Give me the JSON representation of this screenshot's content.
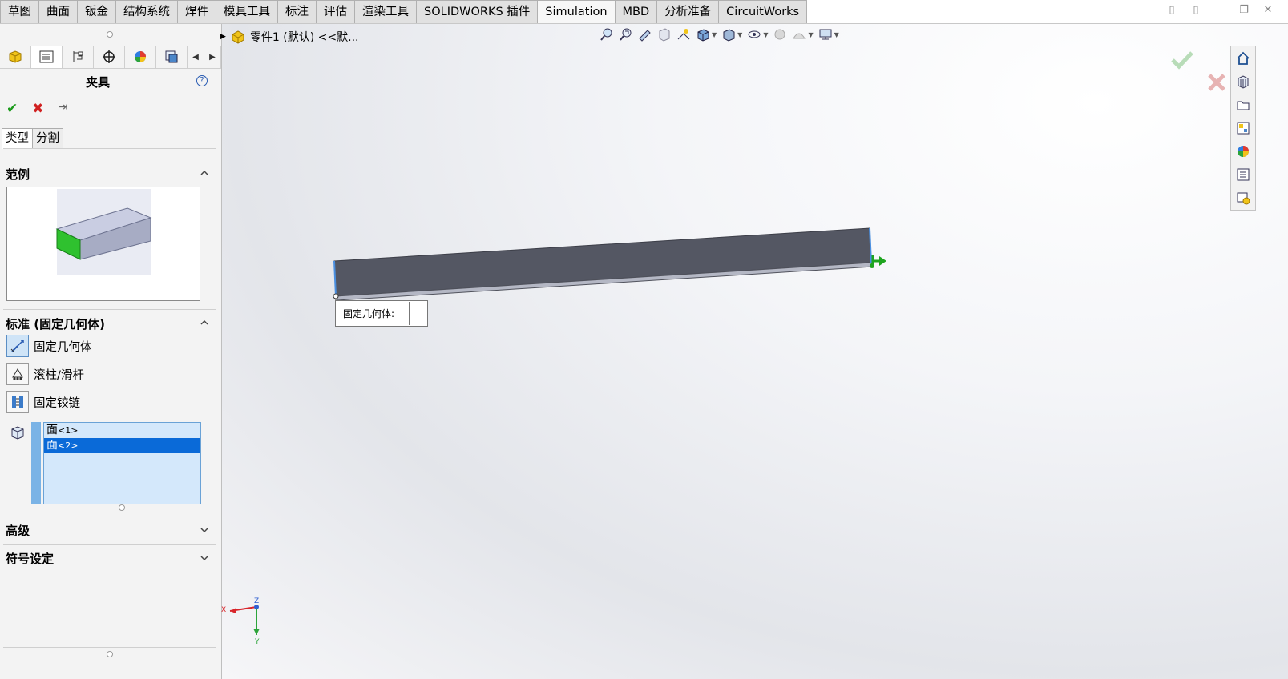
{
  "tabs": [
    {
      "label": "草图",
      "active": false
    },
    {
      "label": "曲面",
      "active": false
    },
    {
      "label": "钣金",
      "active": false
    },
    {
      "label": "结构系统",
      "active": false
    },
    {
      "label": "焊件",
      "active": false
    },
    {
      "label": "模具工具",
      "active": false
    },
    {
      "label": "标注",
      "active": false
    },
    {
      "label": "评估",
      "active": false
    },
    {
      "label": "渲染工具",
      "active": false
    },
    {
      "label": "SOLIDWORKS 插件",
      "active": false
    },
    {
      "label": "Simulation",
      "active": true
    },
    {
      "label": "MBD",
      "active": false
    },
    {
      "label": "分析准备",
      "active": false
    },
    {
      "label": "CircuitWorks",
      "active": false
    }
  ],
  "panel": {
    "title": "夹具",
    "help": "?",
    "subtabs": [
      "类型",
      "分割"
    ],
    "example_section": "范例",
    "standard_section": "标准 (固定几何体)",
    "options": [
      "固定几何体",
      "滚柱/滑杆",
      "固定铰链"
    ],
    "faces": [
      {
        "name": "面",
        "idx": "<1>"
      },
      {
        "name": "面",
        "idx": "<2>"
      }
    ],
    "advanced_section": "高级",
    "symbol_section": "符号设定"
  },
  "viewport": {
    "tree_label": "零件1 (默认) <<默...",
    "callout_label": "固定几何体:",
    "triad": {
      "x": "X",
      "y": "Y",
      "z": "Z"
    }
  },
  "colors": {
    "accent": "#0a6ad8",
    "fixture": "#1fa51f",
    "beam": "#545763"
  }
}
